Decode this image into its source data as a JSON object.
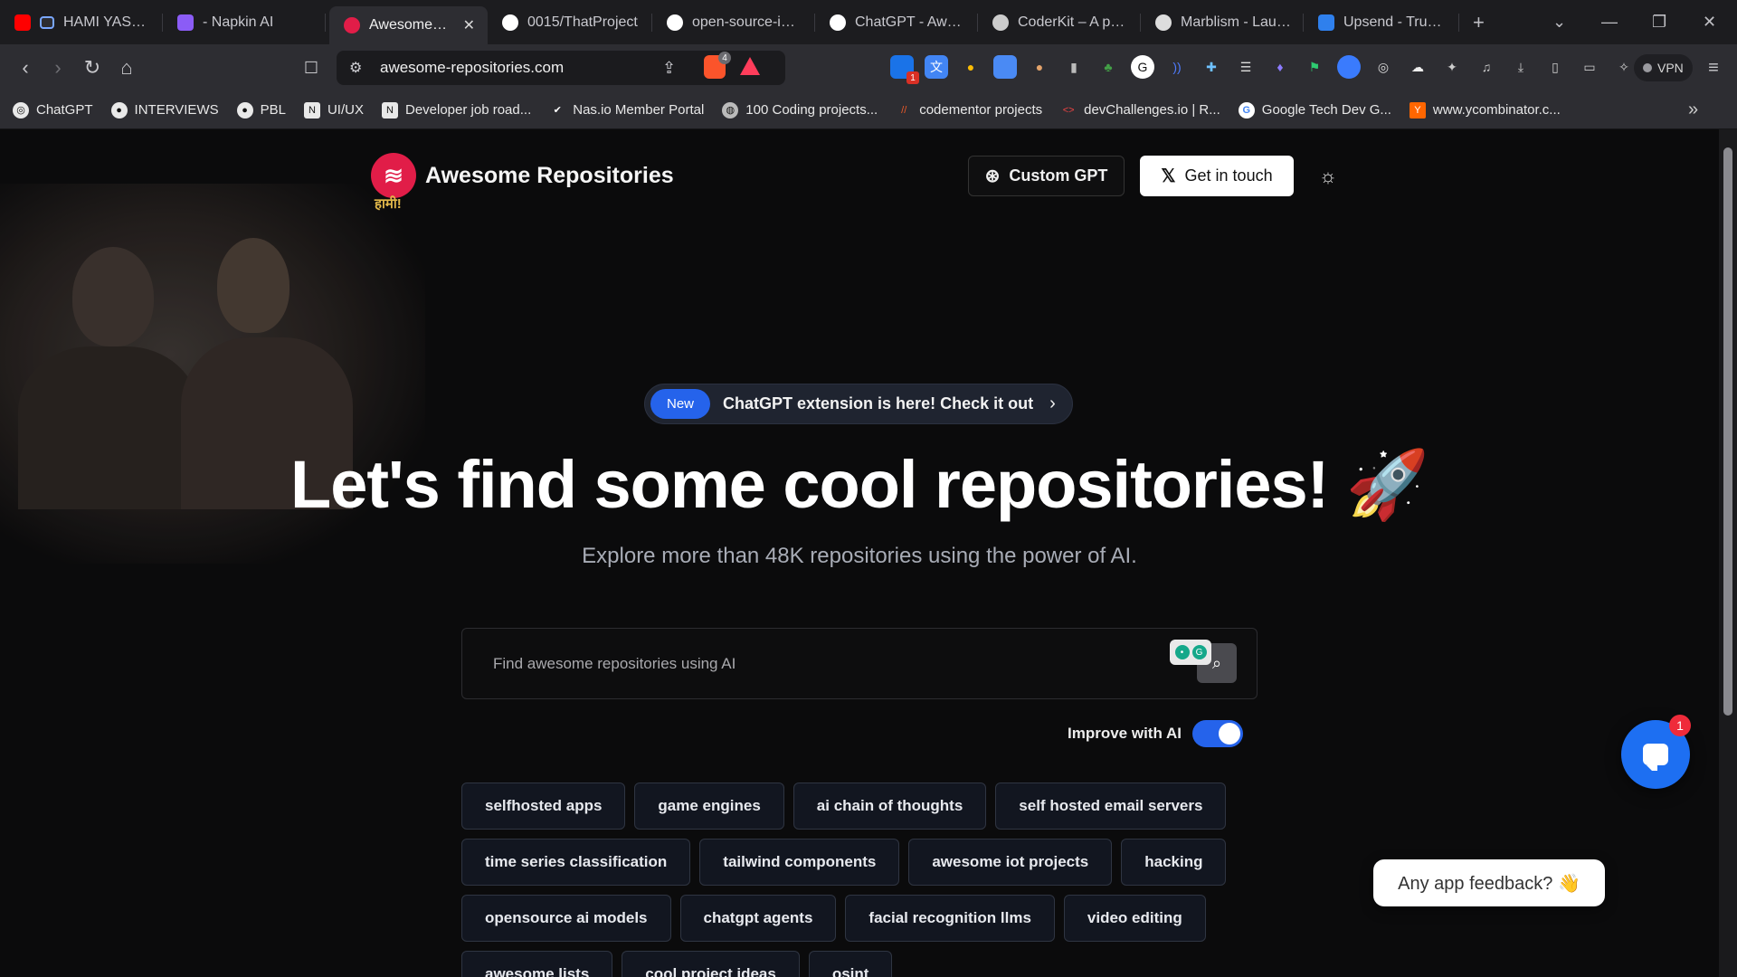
{
  "browser": {
    "tabs": [
      {
        "title": "HAMI YASTAI",
        "fav_color": "#ff0000",
        "active": false
      },
      {
        "title": "- Napkin AI",
        "fav_color": "#8b5cf6",
        "active": false
      },
      {
        "title": "Awesome Fin",
        "fav_color": "#e11d48",
        "active": true
      },
      {
        "title": "0015/ThatProject",
        "fav_color": "#ffffff",
        "active": false
      },
      {
        "title": "open-source-idea",
        "fav_color": "#ffffff",
        "active": false
      },
      {
        "title": "ChatGPT - Aweso",
        "fav_color": "#ffffff",
        "active": false
      },
      {
        "title": "CoderKit – A pow",
        "fav_color": "#cccccc",
        "active": false
      },
      {
        "title": "Marblism - Launc",
        "fav_color": "#dddddd",
        "active": false
      },
      {
        "title": "Upsend - Trust &",
        "fav_color": "#2f80ed",
        "active": false
      }
    ],
    "tab_close": "✕",
    "new_tab": "+",
    "address": "awesome-repositories.com",
    "vpn_label": "VPN",
    "shield_count": "4",
    "bookmarks": [
      "ChatGPT",
      "INTERVIEWS",
      "PBL",
      "UI/UX",
      "Developer job road...",
      "Nas.io Member Portal",
      "100 Coding projects...",
      "codementor projects",
      "devChallenges.io | R...",
      "Google Tech Dev G...",
      "www.ycombinator.c..."
    ],
    "bookmarks_more": "»",
    "ext_badge": "1"
  },
  "header": {
    "brand_name": "Awesome Repositories",
    "brand_sub": "हामी!",
    "custom_gpt_label": "Custom GPT",
    "get_in_touch_label": "Get in touch",
    "theme_icon": "sun-icon"
  },
  "announcement": {
    "badge": "New",
    "text": "ChatGPT extension is here! Check it out",
    "arrow": "›"
  },
  "hero": {
    "title": "Let's find some cool repositories! 🚀",
    "subtitle": "Explore more than 48K repositories using the power of AI."
  },
  "search": {
    "placeholder": "Find awesome repositories using AI",
    "value": ""
  },
  "ai_toggle": {
    "label": "Improve with AI",
    "on": true,
    "on_color": "#2563eb"
  },
  "chips": [
    [
      "selfhosted apps",
      "game engines",
      "ai chain of thoughts",
      "self hosted email servers"
    ],
    [
      "time series classification",
      "tailwind components",
      "awesome iot projects",
      "hacking"
    ],
    [
      "opensource ai models",
      "chatgpt agents",
      "facial recognition llms",
      "video editing"
    ],
    [
      "awesome lists",
      "cool project ideas",
      "osint"
    ]
  ],
  "feedback": {
    "text": "Any app feedback? 👋",
    "badge": "1"
  },
  "colors": {
    "accent": "#2563eb",
    "brand": "#e11d48",
    "background": "#0b0b0c"
  }
}
